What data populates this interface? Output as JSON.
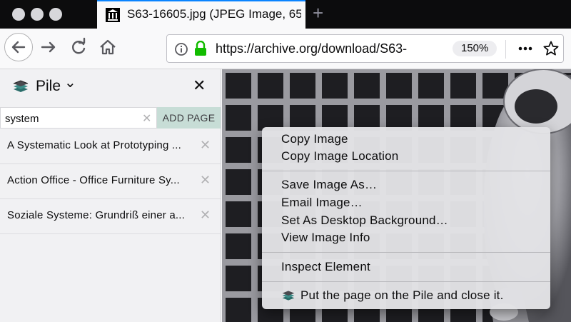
{
  "tab": {
    "title": "S63-16605.jpg (JPEG Image, 65",
    "favicon": "museum-icon"
  },
  "newtab": {
    "label": "+"
  },
  "nav": {
    "url": "https://archive.org/download/S63-",
    "zoom": "150%",
    "icons": [
      "back-icon",
      "forward-icon",
      "reload-icon",
      "home-icon",
      "info-icon",
      "lock-icon",
      "more-icon",
      "bookmark-star-icon"
    ]
  },
  "sidebar": {
    "title": "Pile",
    "chevron": "⌄",
    "close": "✕",
    "search_value": "system",
    "clear": "✕",
    "add_label": "ADD PAGE",
    "items": [
      {
        "label": "A Systematic Look at Prototyping ...",
        "remove": "✕"
      },
      {
        "label": "Action Office - Office Furniture Sy...",
        "remove": "✕"
      },
      {
        "label": "Soziale Systeme: Grundriß einer a...",
        "remove": "✕"
      }
    ]
  },
  "context_menu": {
    "items": [
      "Copy Image",
      "Copy Image Location",
      "Save Image As…",
      "Email Image…",
      "Set As Desktop Background…",
      "View Image Info",
      "Inspect Element",
      "Put the page on the Pile and close it."
    ]
  },
  "colors": {
    "accent": "#0a84ff",
    "titlebar": "#0c0c0d",
    "lock": "#12bc00",
    "add_button": "#c7ddd6"
  }
}
